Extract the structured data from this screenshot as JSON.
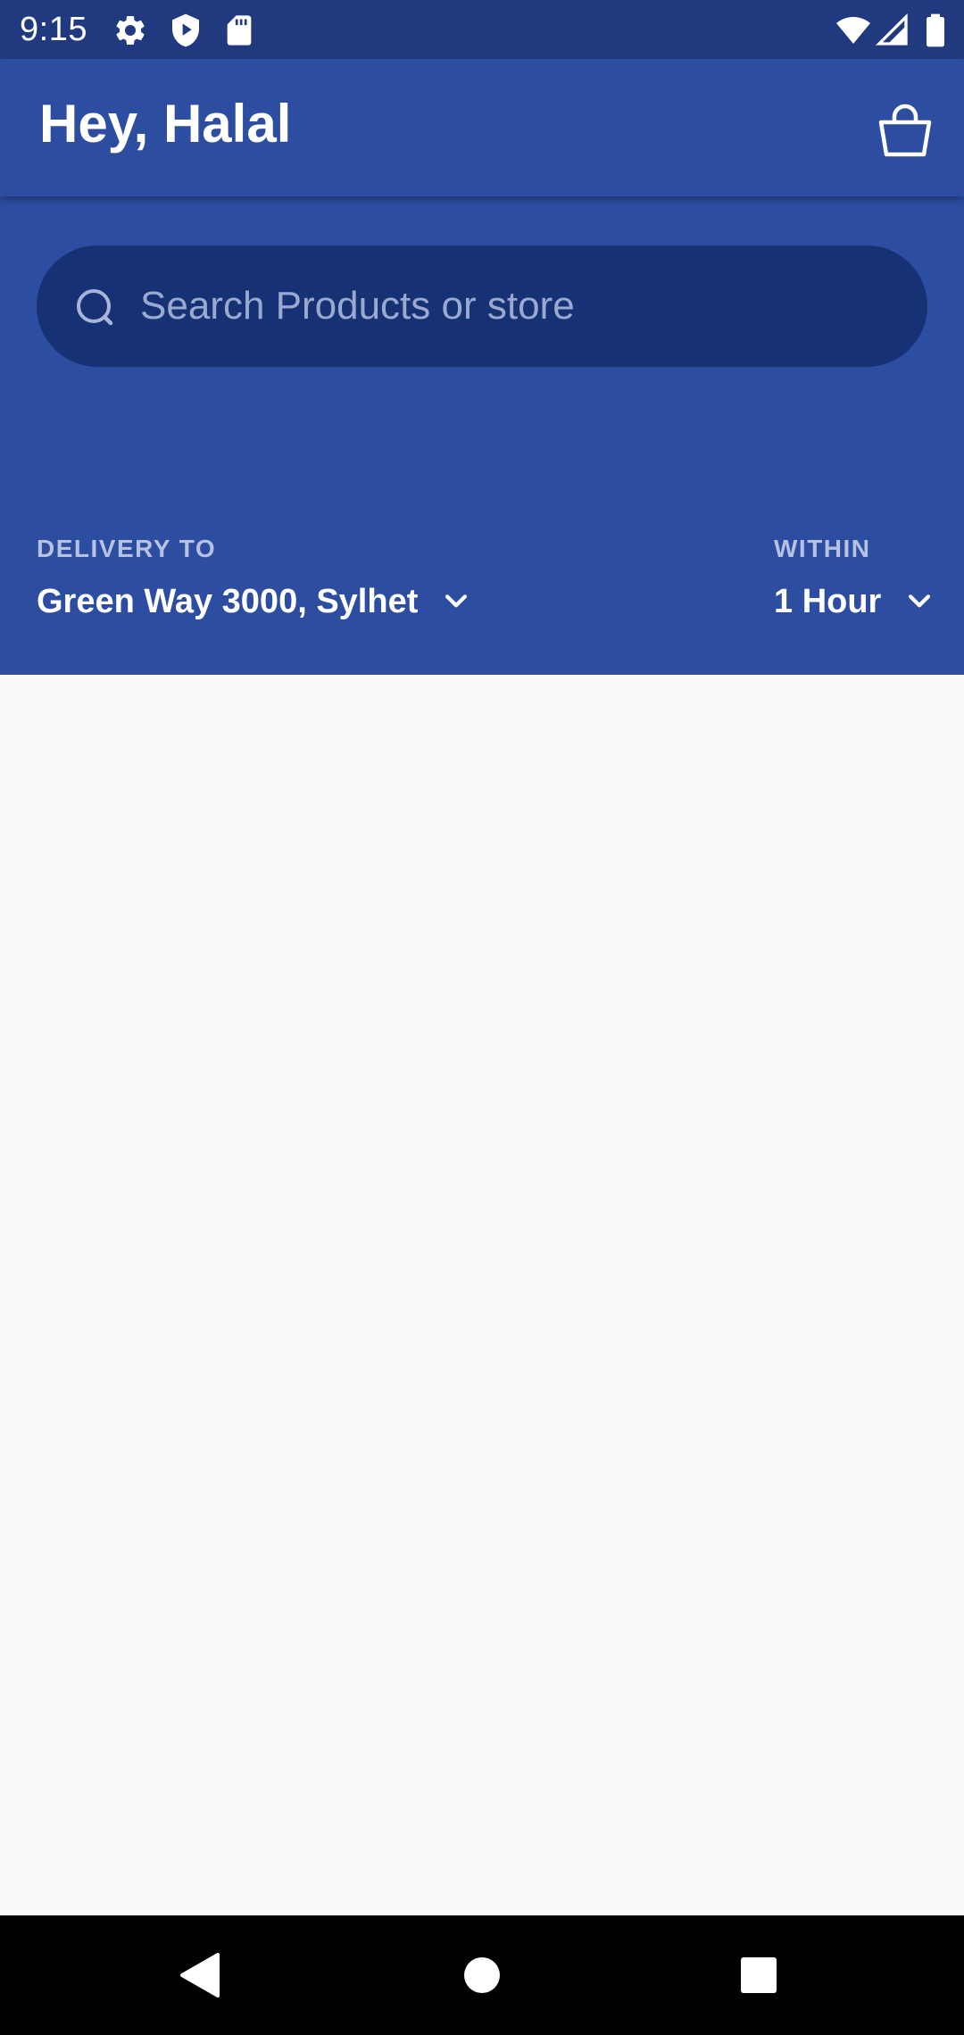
{
  "status_bar": {
    "time": "9:15",
    "left_icons": [
      "gear-icon",
      "shield-play-icon",
      "sd-card-icon"
    ],
    "right_icons": [
      "wifi-icon",
      "cell-signal-icon",
      "battery-icon"
    ]
  },
  "app_bar": {
    "title": "Hey, Halal",
    "cart_icon": "shopping-bag-icon"
  },
  "search": {
    "placeholder": "Search Products or store",
    "value": ""
  },
  "delivery": {
    "label": "DELIVERY TO",
    "value": "Green Way 3000, Sylhet"
  },
  "within": {
    "label": "WITHIN",
    "value": "1 Hour"
  },
  "nav_bar": {
    "buttons": [
      "back-icon",
      "home-icon",
      "recents-icon"
    ]
  },
  "colors": {
    "status_bar": "#213a7f",
    "primary": "#2d4da0",
    "search_background": "#173175",
    "content_background": "#fafafa",
    "nav_bar": "#000000"
  }
}
